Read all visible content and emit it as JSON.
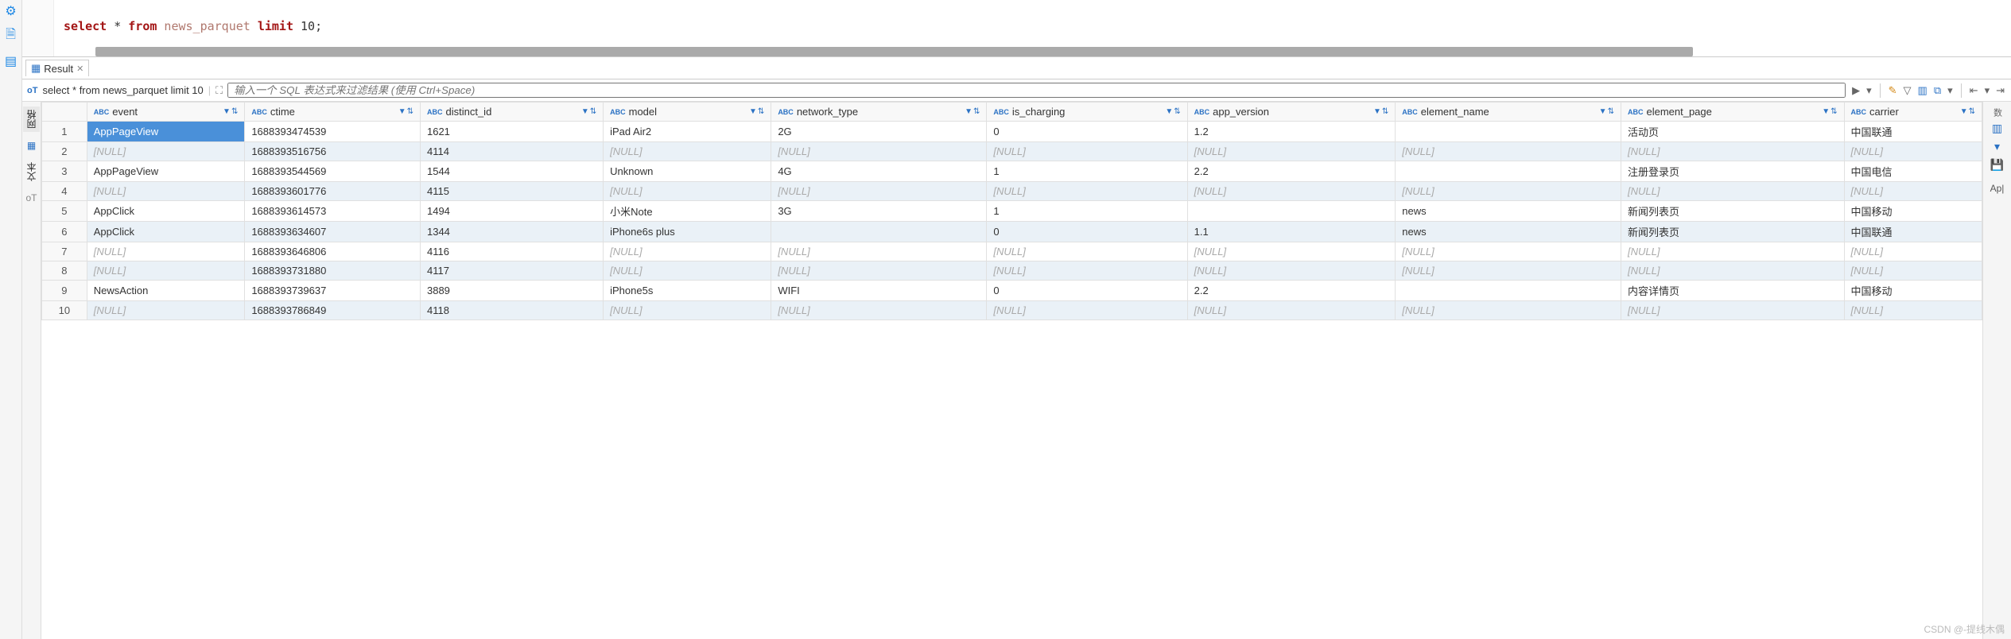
{
  "editor": {
    "sql_select": "select",
    "sql_star": " * ",
    "sql_from": "from",
    "sql_table": " news_parquet ",
    "sql_limit": "limit",
    "sql_n": " 10",
    "sql_semi": ";"
  },
  "result_tab": {
    "label": "Result",
    "close": "✕"
  },
  "query_bar": {
    "prefix": "oT",
    "query": "select * from news_parquet limit 10",
    "filter_placeholder": "输入一个 SQL 表达式来过滤结果 (使用 Ctrl+Space)"
  },
  "side_tabs": {
    "grid": "网格",
    "text": "文本"
  },
  "columns": [
    {
      "type": "ABC",
      "name": "event"
    },
    {
      "type": "ABC",
      "name": "ctime"
    },
    {
      "type": "ABC",
      "name": "distinct_id"
    },
    {
      "type": "ABC",
      "name": "model"
    },
    {
      "type": "ABC",
      "name": "network_type"
    },
    {
      "type": "ABC",
      "name": "is_charging"
    },
    {
      "type": "ABC",
      "name": "app_version"
    },
    {
      "type": "ABC",
      "name": "element_name"
    },
    {
      "type": "ABC",
      "name": "element_page"
    },
    {
      "type": "ABC",
      "name": "carrier"
    }
  ],
  "rows": [
    {
      "n": "1",
      "event": "AppPageView",
      "ctime": "1688393474539",
      "distinct_id": "1621",
      "model": "iPad Air2",
      "network_type": "2G",
      "is_charging": "0",
      "app_version": "1.2",
      "element_name": "",
      "element_page": "活动页",
      "carrier": "中国联通"
    },
    {
      "n": "2",
      "event": null,
      "ctime": "1688393516756",
      "distinct_id": "4114",
      "model": null,
      "network_type": null,
      "is_charging": null,
      "app_version": null,
      "element_name": null,
      "element_page": null,
      "carrier": null
    },
    {
      "n": "3",
      "event": "AppPageView",
      "ctime": "1688393544569",
      "distinct_id": "1544",
      "model": "Unknown",
      "network_type": "4G",
      "is_charging": "1",
      "app_version": "2.2",
      "element_name": "",
      "element_page": "注册登录页",
      "carrier": "中国电信"
    },
    {
      "n": "4",
      "event": null,
      "ctime": "1688393601776",
      "distinct_id": "4115",
      "model": null,
      "network_type": null,
      "is_charging": null,
      "app_version": null,
      "element_name": null,
      "element_page": null,
      "carrier": null
    },
    {
      "n": "5",
      "event": "AppClick",
      "ctime": "1688393614573",
      "distinct_id": "1494",
      "model": "小米Note",
      "network_type": "3G",
      "is_charging": "1",
      "app_version": "",
      "element_name": "news",
      "element_page": "新闻列表页",
      "carrier": "中国移动"
    },
    {
      "n": "6",
      "event": "AppClick",
      "ctime": "1688393634607",
      "distinct_id": "1344",
      "model": "iPhone6s plus",
      "network_type": "",
      "is_charging": "0",
      "app_version": "1.1",
      "element_name": "news",
      "element_page": "新闻列表页",
      "carrier": "中国联通"
    },
    {
      "n": "7",
      "event": null,
      "ctime": "1688393646806",
      "distinct_id": "4116",
      "model": null,
      "network_type": null,
      "is_charging": null,
      "app_version": null,
      "element_name": null,
      "element_page": null,
      "carrier": null
    },
    {
      "n": "8",
      "event": null,
      "ctime": "1688393731880",
      "distinct_id": "4117",
      "model": null,
      "network_type": null,
      "is_charging": null,
      "app_version": null,
      "element_name": null,
      "element_page": null,
      "carrier": null
    },
    {
      "n": "9",
      "event": "NewsAction",
      "ctime": "1688393739637",
      "distinct_id": "3889",
      "model": "iPhone5s",
      "network_type": "WIFI",
      "is_charging": "0",
      "app_version": "2.2",
      "element_name": "",
      "element_page": "内容详情页",
      "carrier": "中国移动"
    },
    {
      "n": "10",
      "event": null,
      "ctime": "1688393786849",
      "distinct_id": "4118",
      "model": null,
      "network_type": null,
      "is_charging": null,
      "app_version": null,
      "element_name": null,
      "element_page": null,
      "carrier": null
    }
  ],
  "right_rail": {
    "count_label": "数",
    "app_label": "Ap|"
  },
  "null_text": "[NULL]",
  "watermark": "CSDN @-提线木偶"
}
